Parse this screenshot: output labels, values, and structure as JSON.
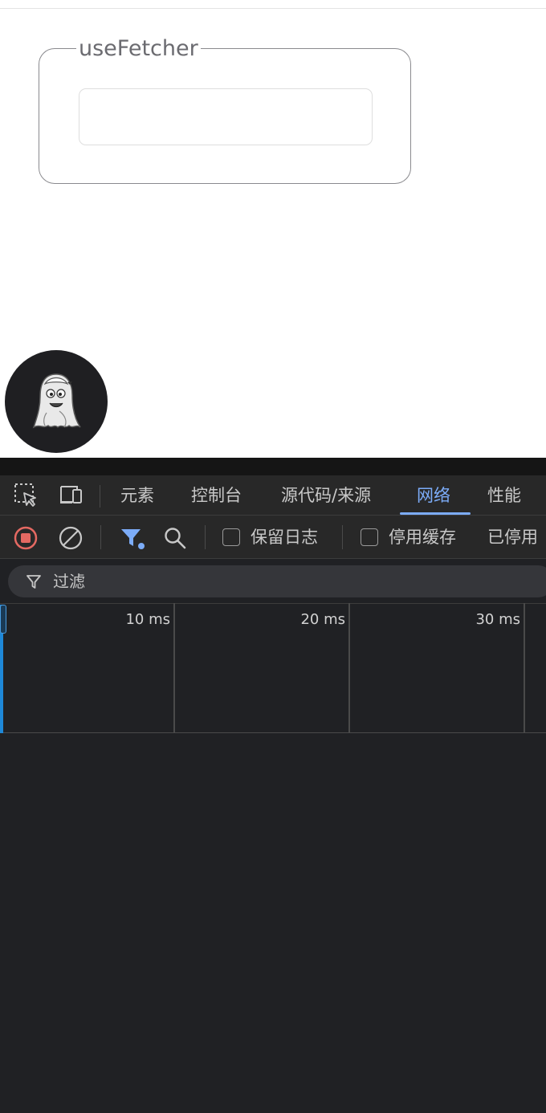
{
  "page": {
    "fieldset_legend": "useFetcher",
    "input_value": "",
    "avatar_icon": "ghost-icon"
  },
  "devtools": {
    "toolbar_icons": [
      "inspect-element-icon",
      "device-toolbar-icon"
    ],
    "tabs": [
      {
        "label": "元素",
        "active": false
      },
      {
        "label": "控制台",
        "active": false
      },
      {
        "label": "源代码/来源",
        "active": false
      },
      {
        "label": "网络",
        "active": true
      },
      {
        "label": "性能",
        "active": false
      }
    ],
    "network_toolbar": {
      "record_icon": "record-stop-icon",
      "clear_icon": "clear-icon",
      "filter_icon": "filter-icon",
      "search_icon": "search-icon",
      "preserve_log": {
        "label": "保留日志",
        "checked": false
      },
      "disable_cache": {
        "label": "停用缓存",
        "checked": false
      },
      "throttling_label": "已停用"
    },
    "filter": {
      "placeholder": "过滤"
    },
    "timeline": {
      "ticks": [
        "10 ms",
        "20 ms",
        "30 ms"
      ]
    },
    "colors": {
      "accent": "#7cacf8",
      "record": "#e46962",
      "background": "#202124"
    }
  }
}
